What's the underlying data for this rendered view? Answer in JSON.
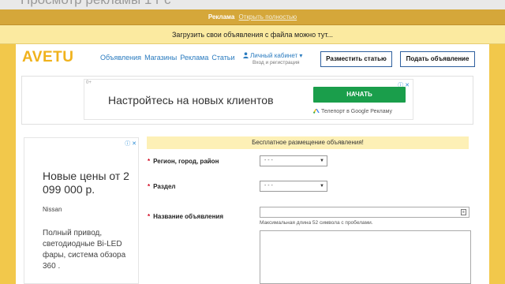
{
  "video_title": "Просмотр рекламы 1 г с",
  "ad_bar": {
    "label": "Реклама",
    "link": "Открыть полностью"
  },
  "notice": "Загрузить свои объявления с файла можно тут...",
  "header": {
    "logo": "AVETU",
    "nav": [
      "Объявления",
      "Магазины",
      "Реклама",
      "Статьи"
    ],
    "account_label": "Личный кабинет ▾",
    "account_sub": "Вход и регистрация",
    "post_article": "Разместить статью",
    "post_ad": "Подать объявление"
  },
  "top_ad": {
    "corner": "0+",
    "headline": "Настройтесь на новых клиентов",
    "cta": "НАЧАТЬ",
    "source": "Телепорт в Google Рекламу",
    "adchoices": "ⓘ ✕"
  },
  "side_ad": {
    "adchoices": "ⓘ ✕",
    "title": "Новые цены от 2 099 000 р.",
    "brand": "Nissan",
    "desc": "Полный привод, светодиодные Bi-LED фары, система обзора 360 ."
  },
  "form": {
    "banner": "Бесплатное размещение объявления!",
    "region_label": "Регион, город, район",
    "region_value": "- - -",
    "section_label": "Раздел",
    "section_value": "- - -",
    "title_label": "Название объявления",
    "title_hint": "Максимальная длина 52 символа с пробелами.",
    "required_mark": "*"
  },
  "colors": {
    "background": "#f2c84b",
    "accent_link": "#2a7bbf",
    "logo": "#f0b21c",
    "cta_green": "#1a9e4b",
    "required": "#d0021b"
  }
}
